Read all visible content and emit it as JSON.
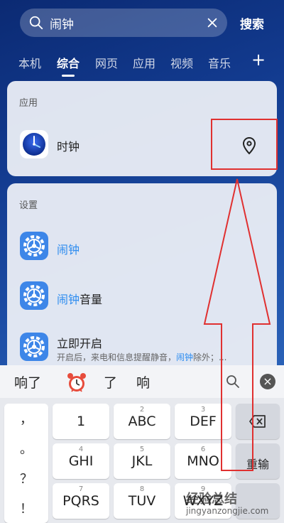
{
  "search": {
    "query": "闹钟",
    "button_label": "搜索"
  },
  "tabs": [
    {
      "label": "本机"
    },
    {
      "label": "综合"
    },
    {
      "label": "网页"
    },
    {
      "label": "应用"
    },
    {
      "label": "视频"
    },
    {
      "label": "音乐"
    }
  ],
  "tabs_add_label": "+",
  "apps_section": {
    "title": "应用",
    "item_name": "时钟"
  },
  "settings_section": {
    "title": "设置",
    "items": [
      {
        "highlight": "闹钟",
        "rest": ""
      },
      {
        "highlight": "闹钟",
        "rest": "音量"
      },
      {
        "highlight": "",
        "rest": "立即开启",
        "sub_before": "开启后，来电和信息提醒静音，",
        "sub_highlight": "闹钟",
        "sub_after": "除外；..."
      }
    ]
  },
  "keyboard": {
    "candidates": [
      "响了",
      "了",
      "响"
    ],
    "punctuation": [
      "，",
      "。",
      "？",
      "！"
    ],
    "keys": [
      {
        "num": "",
        "label": "1"
      },
      {
        "num": "2",
        "label": "ABC"
      },
      {
        "num": "3",
        "label": "DEF"
      },
      {
        "num": "4",
        "label": "GHI"
      },
      {
        "num": "5",
        "label": "JKL"
      },
      {
        "num": "6",
        "label": "MNO"
      },
      {
        "num": "7",
        "label": "PQRS"
      },
      {
        "num": "8",
        "label": "TUV"
      },
      {
        "num": "9",
        "label": "WXYZ"
      }
    ],
    "reenter_label": "重输"
  },
  "watermark": {
    "line1": "经验总结",
    "line2": "jingyanzongjie.com"
  },
  "colors": {
    "accent": "#2d8cf0",
    "annotation": "#e03030"
  }
}
